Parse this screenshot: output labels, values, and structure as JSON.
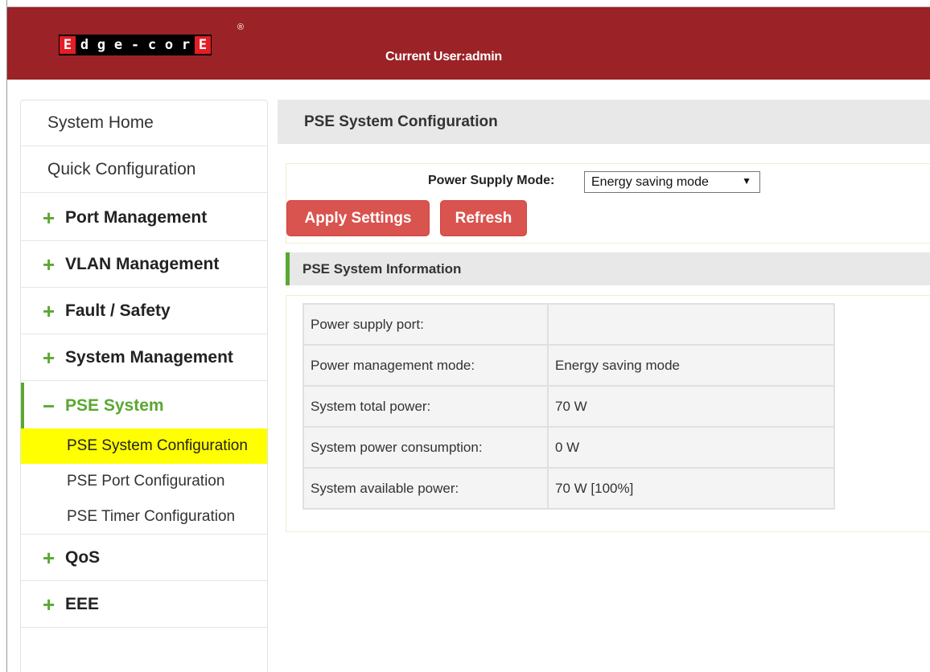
{
  "header": {
    "logo_letters": [
      "E",
      "d",
      "g",
      "e",
      "-",
      "c",
      "o",
      "r",
      "E"
    ],
    "logo_registered": "®",
    "current_user_label": "Current User:",
    "current_user": "admin",
    "color": "#9b2226"
  },
  "sidebar": {
    "items": [
      {
        "label": "System Home",
        "type": "plain"
      },
      {
        "label": "Quick Configuration",
        "type": "plain"
      },
      {
        "label": "Port Management",
        "type": "group",
        "icon": "plus-icon"
      },
      {
        "label": "VLAN Management",
        "type": "group",
        "icon": "plus-icon"
      },
      {
        "label": "Fault / Safety",
        "type": "group",
        "icon": "plus-icon"
      },
      {
        "label": "System Management",
        "type": "group",
        "icon": "plus-icon"
      },
      {
        "label": "PSE System",
        "type": "group",
        "icon": "minus-icon",
        "expanded": true
      },
      {
        "label": "QoS",
        "type": "group",
        "icon": "plus-icon"
      },
      {
        "label": "EEE",
        "type": "group",
        "icon": "plus-icon"
      }
    ],
    "pse_sub_items": [
      {
        "label": "PSE System Configuration",
        "selected": true
      },
      {
        "label": "PSE Port Configuration",
        "selected": false
      },
      {
        "label": "PSE Timer Configuration",
        "selected": false
      }
    ],
    "plus_glyph": "+",
    "minus_glyph": "−",
    "accent_color": "#5aa832",
    "selected_color": "#ffff00"
  },
  "main": {
    "title": "PSE System Configuration",
    "power_supply_mode_label": "Power Supply Mode:",
    "power_supply_mode_value": "Energy saving mode",
    "dropdown_arrow": "▼",
    "apply_label": "Apply Settings",
    "refresh_label": "Refresh",
    "button_color": "#d9534f",
    "info_title": "PSE System Information",
    "info_rows": [
      {
        "label": "Power supply port:",
        "value": ""
      },
      {
        "label": "Power management mode:",
        "value": "Energy saving mode"
      },
      {
        "label": "System total power:",
        "value": "70 W"
      },
      {
        "label": "System power consumption:",
        "value": "0 W"
      },
      {
        "label": "System available power:",
        "value": "70 W [100%]"
      }
    ]
  }
}
